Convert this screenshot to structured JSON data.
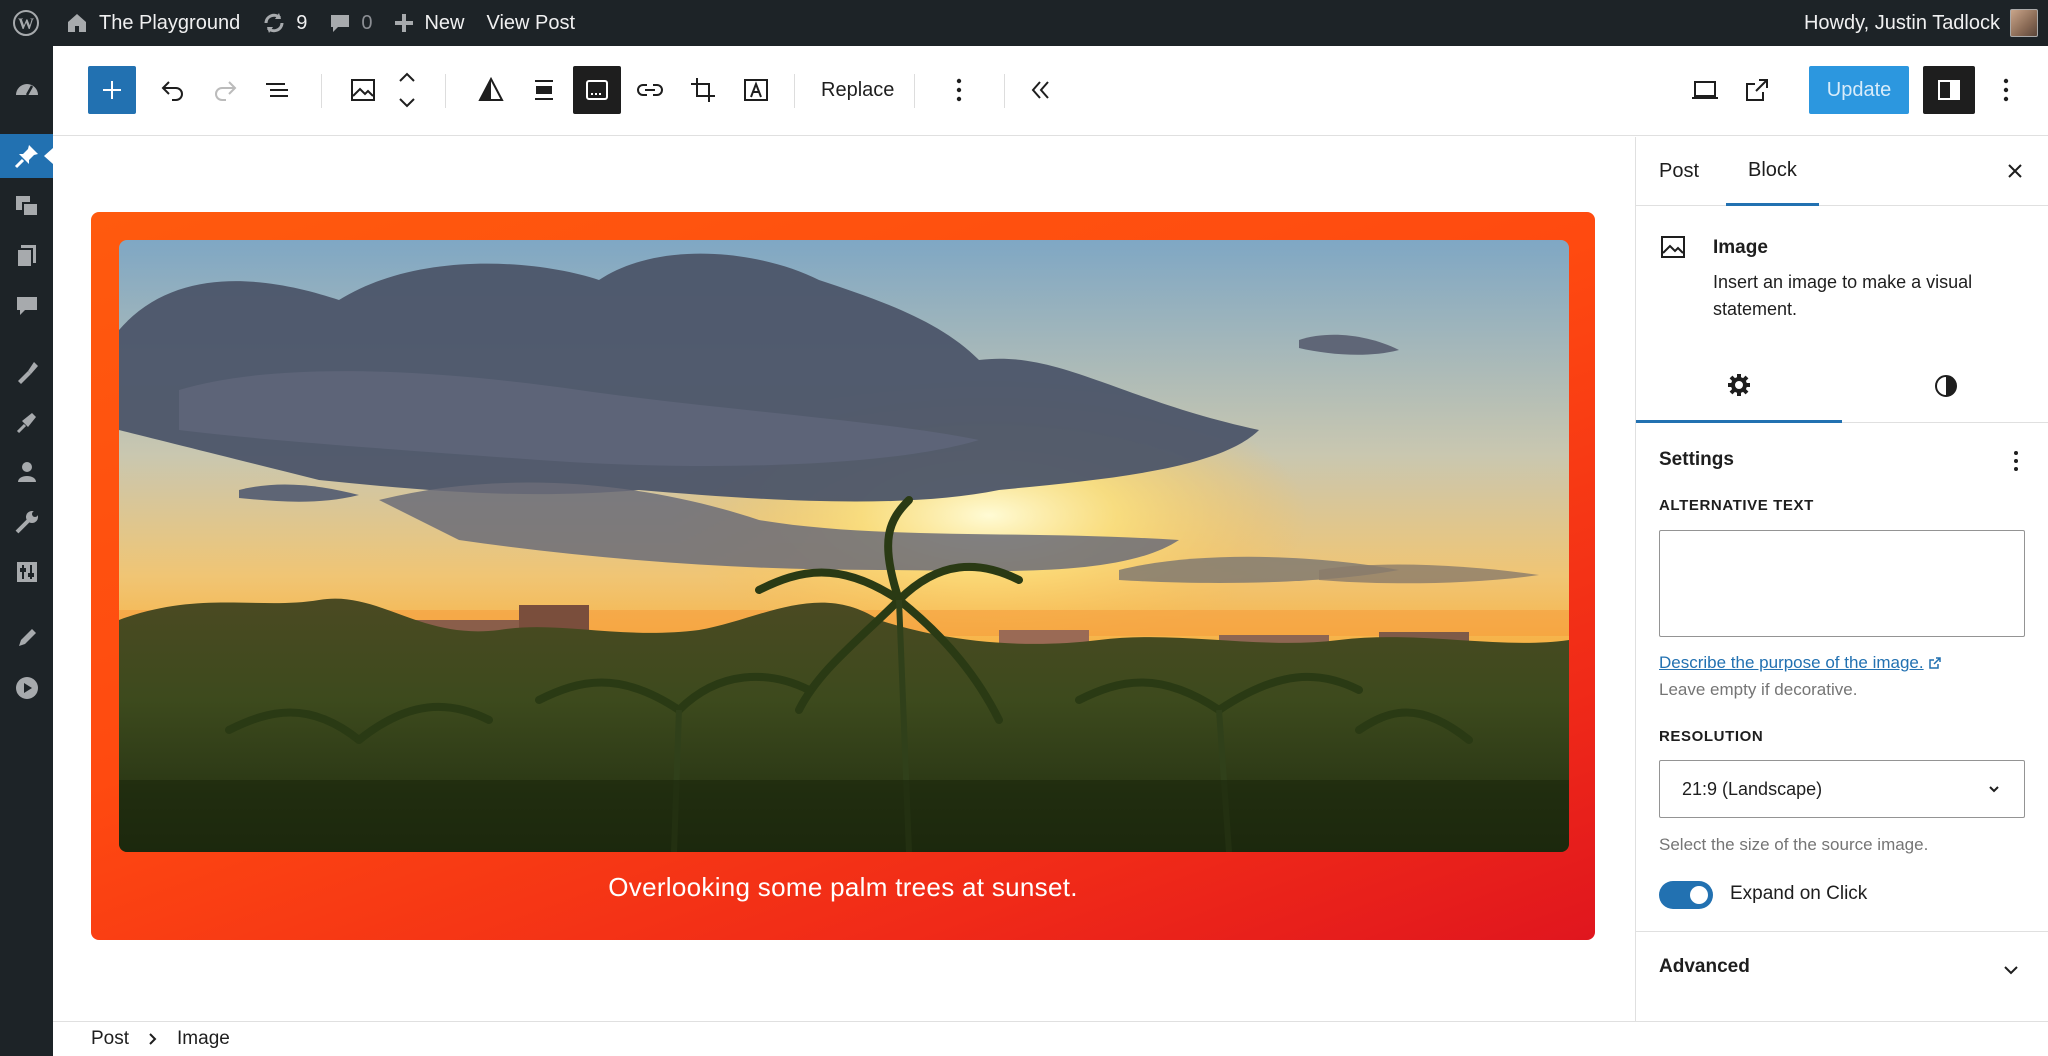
{
  "admin_bar": {
    "site_name": "The Playground",
    "updates_count": "9",
    "comments_count": "0",
    "new_label": "New",
    "view_post_label": "View Post",
    "greeting": "Howdy, Justin Tadlock"
  },
  "admin_menu": {
    "items": [
      "dashboard-icon",
      "pin-icon",
      "media-icon",
      "pages-icon",
      "comments-icon",
      "appearance-icon",
      "plugins-icon",
      "users-icon",
      "tools-icon",
      "settings-icon",
      "edit-icon",
      "play-icon"
    ],
    "active_item": "pin-icon"
  },
  "toolbar": {
    "replace_label": "Replace",
    "update_label": "Update"
  },
  "canvas": {
    "caption": "Overlooking some palm trees at sunset."
  },
  "sidebar": {
    "tabs": [
      {
        "label": "Post"
      },
      {
        "label": "Block"
      }
    ],
    "active_tab": "Block",
    "block": {
      "title": "Image",
      "description": "Insert an image to make a visual statement."
    },
    "settings": {
      "title": "Settings",
      "alt_text_label": "ALTERNATIVE TEXT",
      "alt_text_value": "",
      "alt_link": "Describe the purpose of the image.",
      "alt_help": "Leave empty if decorative.",
      "resolution_label": "RESOLUTION",
      "resolution_value": "21:9 (Landscape)",
      "resolution_help": "Select the size of the source image.",
      "expand_on_click_label": "Expand on Click",
      "expand_on_click": true
    },
    "advanced_label": "Advanced"
  },
  "breadcrumb": {
    "items": [
      "Post",
      "Image"
    ]
  },
  "colors": {
    "admin_bg": "#1d2327",
    "accent": "#2271b1",
    "update_button": "#2c97df",
    "card_gradient_start": "#ff5a0e",
    "card_gradient_end": "#e0161e"
  }
}
